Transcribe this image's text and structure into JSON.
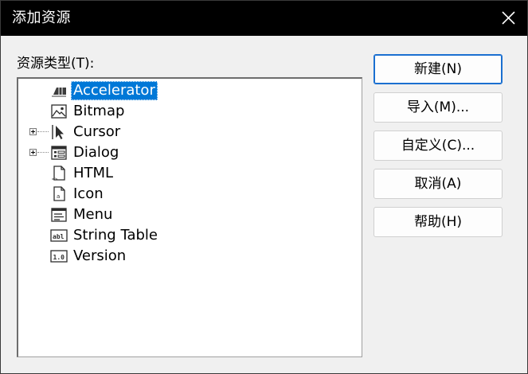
{
  "window": {
    "title": "添加资源",
    "close_icon": "close-icon"
  },
  "tree": {
    "label": "资源类型(T):",
    "items": [
      {
        "label": "Accelerator",
        "icon": "accelerator-icon",
        "selected": true,
        "expandable": false
      },
      {
        "label": "Bitmap",
        "icon": "bitmap-icon",
        "selected": false,
        "expandable": false
      },
      {
        "label": "Cursor",
        "icon": "cursor-icon",
        "selected": false,
        "expandable": true
      },
      {
        "label": "Dialog",
        "icon": "dialog-icon",
        "selected": false,
        "expandable": true
      },
      {
        "label": "HTML",
        "icon": "html-icon",
        "selected": false,
        "expandable": false
      },
      {
        "label": "Icon",
        "icon": "icon-resource-icon",
        "selected": false,
        "expandable": false
      },
      {
        "label": "Menu",
        "icon": "menu-icon",
        "selected": false,
        "expandable": false
      },
      {
        "label": "String Table",
        "icon": "string-table-icon",
        "selected": false,
        "expandable": false
      },
      {
        "label": "Version",
        "icon": "version-icon",
        "selected": false,
        "expandable": false
      }
    ]
  },
  "buttons": {
    "new": "新建(N)",
    "import": "导入(M)...",
    "custom": "自定义(C)...",
    "cancel": "取消(A)",
    "help": "帮助(H)"
  },
  "colors": {
    "titlebar": "#000000",
    "selection": "#0078d7",
    "default_button_border": "#1a6fd0",
    "dialog_background": "#f0f0f0"
  }
}
